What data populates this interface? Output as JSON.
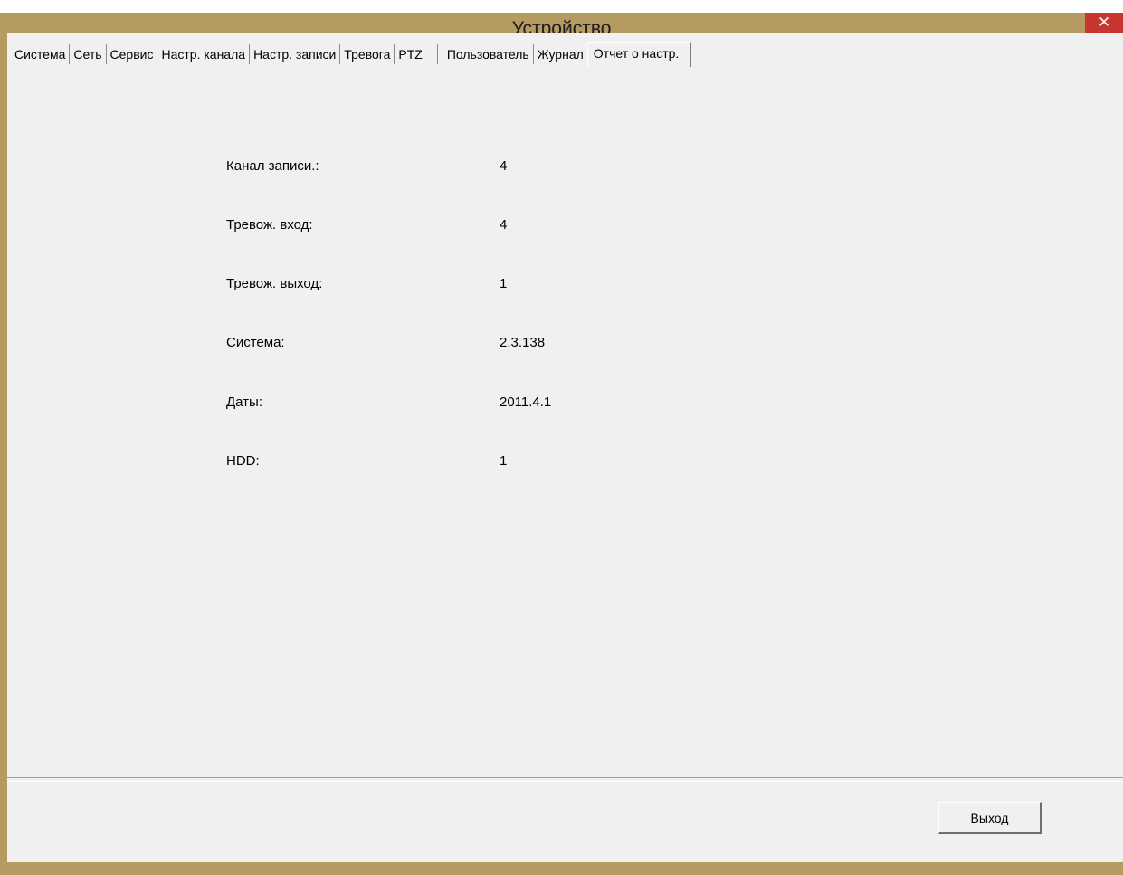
{
  "window": {
    "title": "Устройство",
    "close_glyph": "✕"
  },
  "tabs": [
    {
      "label": "Система"
    },
    {
      "label": "Сеть"
    },
    {
      "label": "Сервис"
    },
    {
      "label": "Настр. канала"
    },
    {
      "label": "Настр. записи"
    },
    {
      "label": "Тревога"
    },
    {
      "label": "PTZ"
    },
    {
      "label": "Пользователь"
    },
    {
      "label": "Журнал"
    },
    {
      "label": "Отчет о настр."
    }
  ],
  "active_tab": "Отчет о настр.",
  "report": {
    "rows": [
      {
        "label": "Канал записи.:",
        "value": "4"
      },
      {
        "label": "Тревож. вход:",
        "value": "4"
      },
      {
        "label": "Тревож. выход:",
        "value": "1"
      },
      {
        "label": "Система:",
        "value": "2.3.138"
      },
      {
        "label": "Даты:",
        "value": "2011.4.1"
      },
      {
        "label": "HDD:",
        "value": "1"
      }
    ]
  },
  "footer": {
    "exit_label": "Выход"
  },
  "colors": {
    "frame": "#b59a62",
    "client": "#f0f0f0",
    "close": "#c7372f"
  }
}
